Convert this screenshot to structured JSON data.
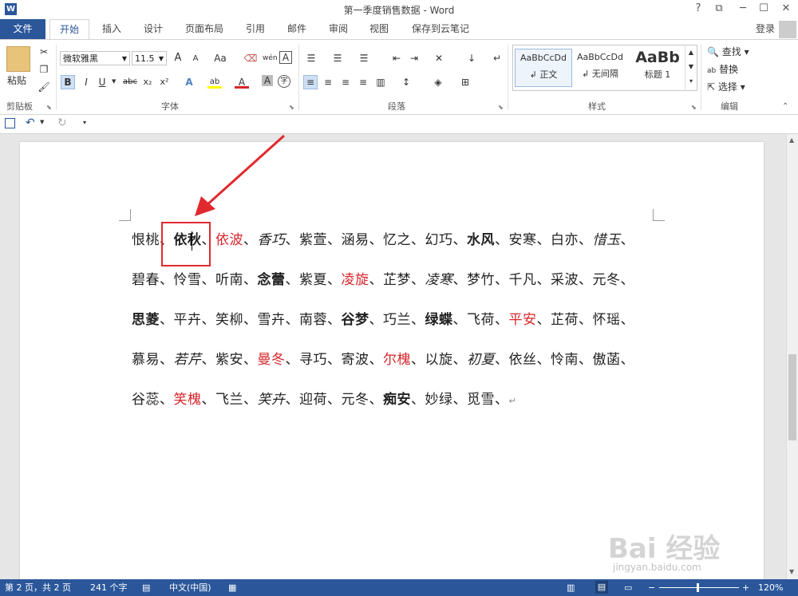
{
  "window": {
    "title": "第一季度销售数据 - Word",
    "help": "?",
    "minimize": "─",
    "maximize": "☐",
    "close": "✕"
  },
  "tabs": {
    "file": "文件",
    "items": [
      "开始",
      "插入",
      "设计",
      "页面布局",
      "引用",
      "邮件",
      "审阅",
      "视图",
      "保存到云笔记"
    ],
    "login": "登录"
  },
  "ribbon": {
    "clipboard": {
      "paste": "粘贴",
      "label": "剪贴板"
    },
    "font": {
      "name": "微软雅黑",
      "size": "11.5",
      "grow": "A",
      "shrink": "A",
      "case": "Aa",
      "bold": "B",
      "italic": "I",
      "underline": "U",
      "strike": "abc",
      "subscript": "x₂",
      "superscript": "x²",
      "label": "字体"
    },
    "paragraph": {
      "label": "段落"
    },
    "styles": {
      "items": [
        {
          "preview": "AaBbCcDd",
          "name": "↲ 正文"
        },
        {
          "preview": "AaBbCcDd",
          "name": "↲ 无间隔"
        },
        {
          "preview": "AaBb",
          "name": "标题 1"
        }
      ],
      "label": "样式"
    },
    "editing": {
      "find": "查找",
      "replace": "替换",
      "select": "选择",
      "label": "编辑"
    }
  },
  "document": {
    "lines": [
      [
        {
          "t": "恨桃、"
        },
        {
          "t": "依秋",
          "b": true
        },
        {
          "t": "、"
        },
        {
          "t": "依波",
          "red": true
        },
        {
          "t": "、"
        },
        {
          "t": "香巧",
          "i": true
        },
        {
          "t": "、紫萱、涵易、忆之、幻巧、"
        },
        {
          "t": "水风",
          "b": true
        },
        {
          "t": "、安寒、白亦、"
        },
        {
          "t": "惜玉",
          "i": true
        },
        {
          "t": "、"
        }
      ],
      [
        {
          "t": "碧春、怜雪、听南、"
        },
        {
          "t": "念蕾",
          "b": true
        },
        {
          "t": "、紫夏、"
        },
        {
          "t": "凌旋",
          "red": true
        },
        {
          "t": "、芷梦、"
        },
        {
          "t": "凌寒",
          "i": true
        },
        {
          "t": "、梦竹、千凡、采波、元冬、"
        }
      ],
      [
        {
          "t": "思菱",
          "b": true
        },
        {
          "t": "、平卉、笑柳、雪卉、南蓉、"
        },
        {
          "t": "谷梦",
          "b": true
        },
        {
          "t": "、巧兰、"
        },
        {
          "t": "绿蝶",
          "b": true
        },
        {
          "t": "、飞荷、"
        },
        {
          "t": "平安",
          "red": true
        },
        {
          "t": "、芷荷、怀瑶、"
        }
      ],
      [
        {
          "t": "慕易、"
        },
        {
          "t": "若芹",
          "i": true
        },
        {
          "t": "、紫安、"
        },
        {
          "t": "曼冬",
          "red": true
        },
        {
          "t": "、寻巧、寄波、"
        },
        {
          "t": "尔槐",
          "red": true
        },
        {
          "t": "、以旋、"
        },
        {
          "t": "初夏",
          "i": true
        },
        {
          "t": "、依丝、怜南、傲菡、"
        }
      ],
      [
        {
          "t": "谷蕊、"
        },
        {
          "t": "笑槐",
          "red": true
        },
        {
          "t": "、飞兰、"
        },
        {
          "t": "笑卉",
          "i": true
        },
        {
          "t": "、迎荷、元冬、"
        },
        {
          "t": "痴安",
          "b": true
        },
        {
          "t": "、妙绿、觅雪、"
        },
        {
          "t": "↵"
        }
      ]
    ]
  },
  "status": {
    "page": "第 2 页，共 2 页",
    "words": "241 个字",
    "language": "中文(中国)",
    "zoom": "120%"
  },
  "watermark": {
    "main": "Bai 经验",
    "url": "jingyan.baidu.com"
  },
  "colors": {
    "accent": "#2b579a",
    "red_text": "#d7262b",
    "highlight_box": "#e0292f"
  }
}
